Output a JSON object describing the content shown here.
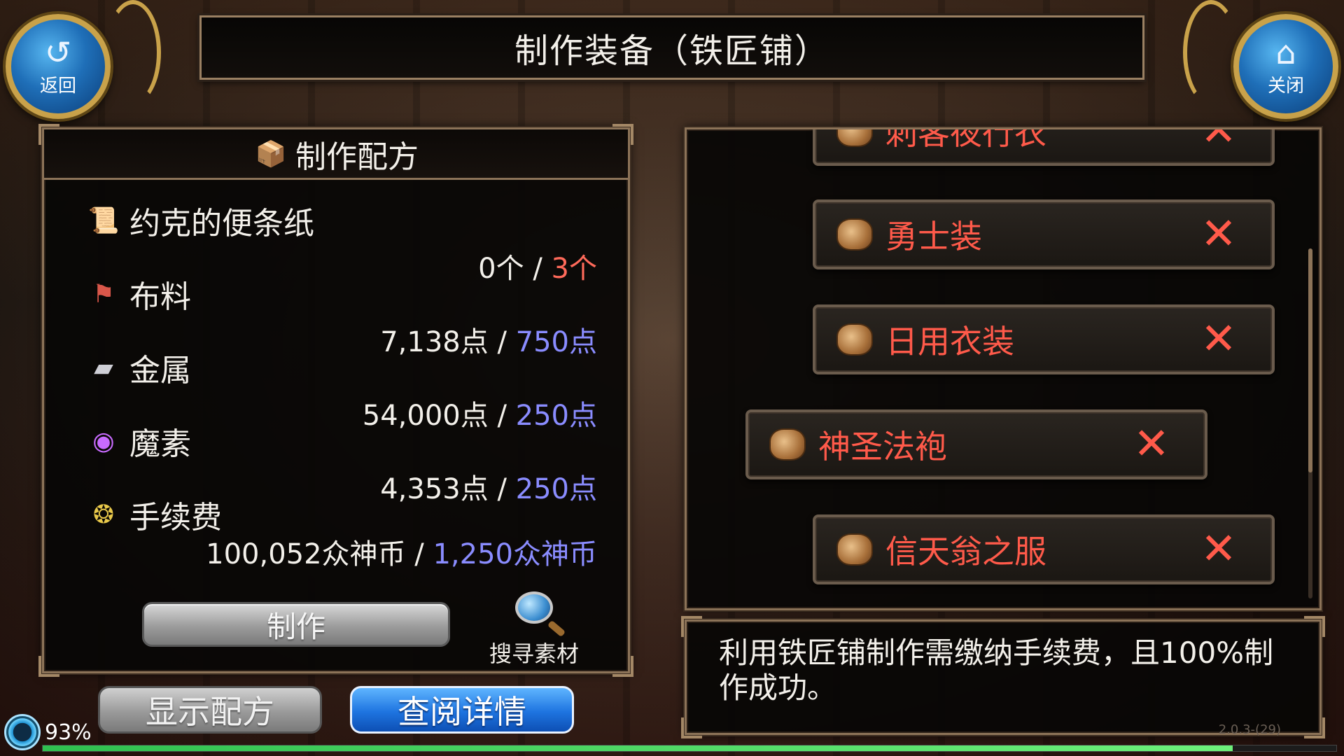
{
  "header": {
    "title": "制作装备（铁匠铺）",
    "back_label": "返回",
    "close_label": "关闭"
  },
  "recipe_panel": {
    "title": "制作配方",
    "materials": [
      {
        "name": "约克的便条纸",
        "icon": "scroll-icon",
        "have": "0个",
        "need": "3个",
        "need_color": "#ff6a5a"
      },
      {
        "name": "布料",
        "icon": "cloth-icon",
        "have": "7,138点",
        "need": "750点",
        "need_color": "#8a8cff"
      },
      {
        "name": "金属",
        "icon": "metal-ingot-icon",
        "have": "54,000点",
        "need": "250点",
        "need_color": "#8a8cff"
      },
      {
        "name": "魔素",
        "icon": "mana-orb-icon",
        "have": "4,353点",
        "need": "250点",
        "need_color": "#8a8cff"
      },
      {
        "name": "手续费",
        "icon": "coins-icon",
        "have": "100,052众神币",
        "need": "1,250众神币",
        "need_color": "#8a8cff"
      }
    ],
    "separator": "/",
    "make_label": "制作",
    "search_label": "搜寻素材"
  },
  "bottom_buttons": {
    "show_recipe": "显示配方",
    "view_detail": "查阅详情"
  },
  "item_list": [
    {
      "name": "刺客夜行衣",
      "mark": "✕"
    },
    {
      "name": "勇士装",
      "mark": "✕"
    },
    {
      "name": "日用衣装",
      "mark": "✕"
    },
    {
      "name": "神圣法袍",
      "mark": "✕",
      "selected": true
    },
    {
      "name": "信天翁之服",
      "mark": "✕"
    }
  ],
  "info": {
    "text": "利用铁匠铺制作需缴纳手续费，且100%制作成功。"
  },
  "status": {
    "battery_or_load": "93%",
    "exp_fraction": 0.92,
    "version": "2.0.3-(29)"
  },
  "colors": {
    "accent_blue": "#1e74e0",
    "item_red": "#ff5a4a",
    "frame_gold": "#8c7358"
  }
}
